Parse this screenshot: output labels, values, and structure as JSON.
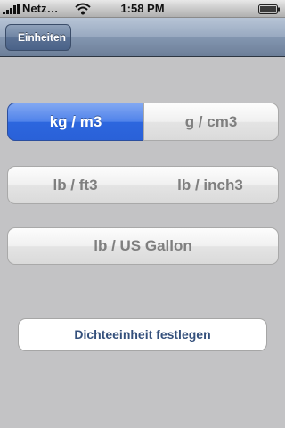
{
  "status_bar": {
    "carrier": "Netz…",
    "time": "1:58 PM",
    "icons": [
      "signal-icon",
      "wifi-icon",
      "battery-icon"
    ]
  },
  "nav": {
    "back_label": "Einheiten"
  },
  "units": {
    "options": [
      {
        "label": "kg / m3",
        "selected": true
      },
      {
        "label": "g / cm3",
        "selected": false
      },
      {
        "label": "lb / ft3",
        "selected": false
      },
      {
        "label": "lb / inch3",
        "selected": false
      },
      {
        "label": "lb / US Gallon",
        "selected": false
      }
    ]
  },
  "actions": {
    "confirm_label": "Dichteeinheit festlegen"
  },
  "colors": {
    "background": "#c3c3c5",
    "selected_segment": "#2c66de",
    "unselected_text": "#7f7f7f",
    "confirm_text": "#34507c"
  }
}
